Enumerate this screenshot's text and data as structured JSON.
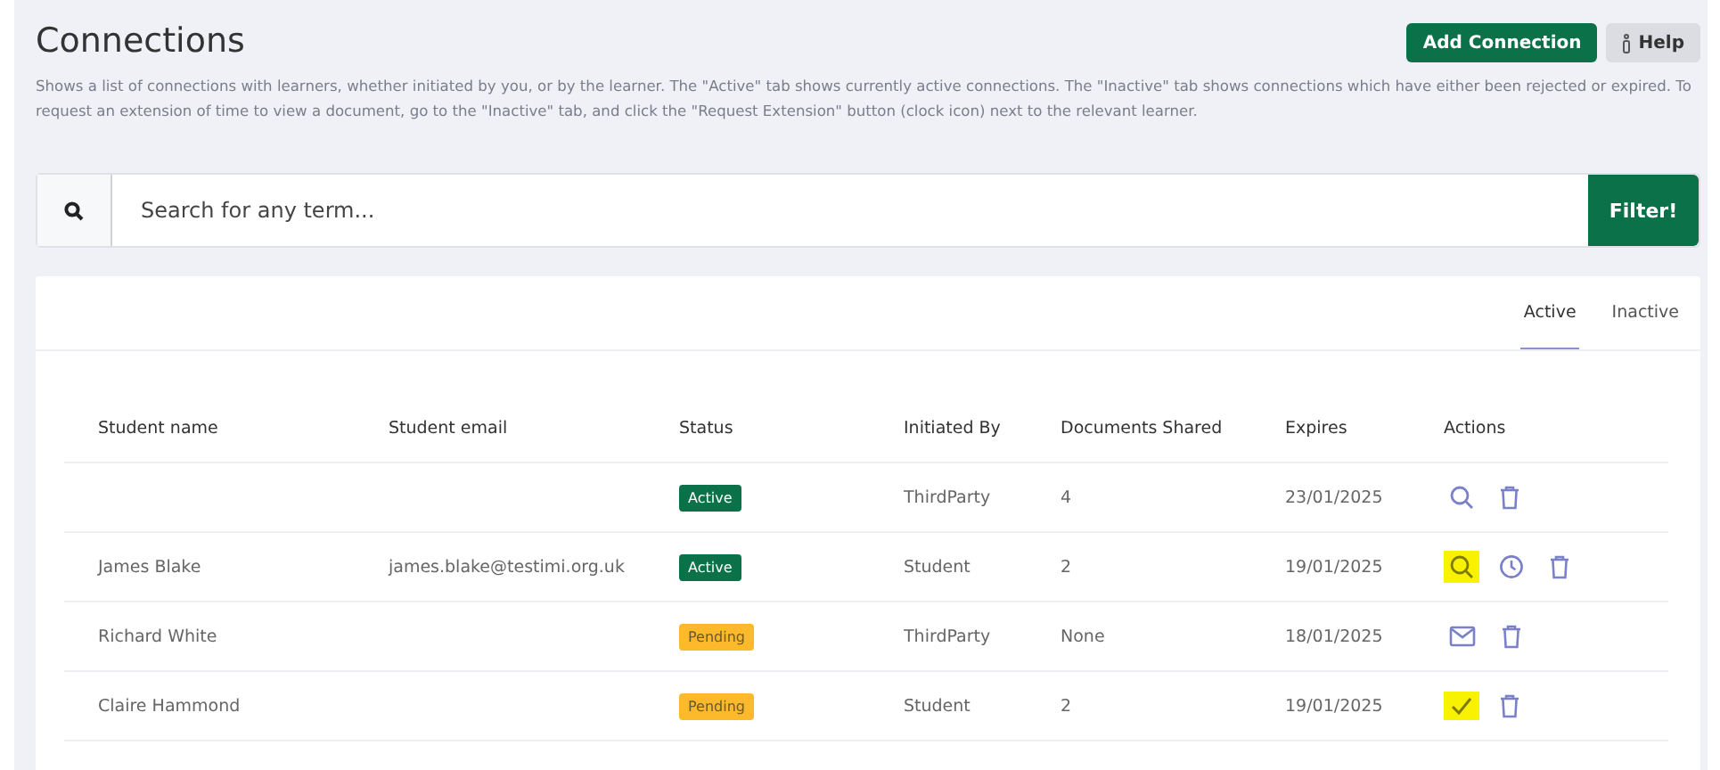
{
  "page": {
    "title": "Connections",
    "description": "Shows a list of connections with learners, whether initiated by you, or by the learner. The \"Active\" tab shows currently active connections. The \"Inactive\" tab shows connections which have either been rejected or expired. To request an extension of time to view a document, go to the \"Inactive\" tab, and click the \"Request Extension\" button (clock icon) next to the relevant learner."
  },
  "header_buttons": [
    {
      "label": "Add Connection",
      "kind": "primary"
    },
    {
      "label": "Help",
      "kind": "help"
    }
  ],
  "search": {
    "placeholder": "Search for any term...",
    "button": "Filter!"
  },
  "tabs": [
    {
      "label": "Active",
      "selected": true
    },
    {
      "label": "Inactive",
      "selected": false
    }
  ],
  "table": {
    "columns": [
      "Student name",
      "Student email",
      "Status",
      "Initiated By",
      "Documents Shared",
      "Expires",
      "Actions"
    ],
    "rows": [
      {
        "name": "",
        "email": "",
        "status": {
          "label": "Active",
          "kind": "active"
        },
        "initiated_by": "ThirdParty",
        "documents": "4",
        "expires": "23/01/2025",
        "actions": [
          {
            "kind": "view",
            "highlighted": false
          },
          {
            "kind": "delete",
            "highlighted": false
          }
        ]
      },
      {
        "name": "James Blake",
        "email": "james.blake@testimi.org.uk",
        "status": {
          "label": "Active",
          "kind": "active"
        },
        "initiated_by": "Student",
        "documents": "2",
        "expires": "19/01/2025",
        "actions": [
          {
            "kind": "view",
            "highlighted": true
          },
          {
            "kind": "extend",
            "highlighted": false
          },
          {
            "kind": "delete",
            "highlighted": false
          }
        ]
      },
      {
        "name": "Richard White",
        "email": "",
        "status": {
          "label": "Pending",
          "kind": "pending"
        },
        "initiated_by": "ThirdParty",
        "documents": "None",
        "expires": "18/01/2025",
        "actions": [
          {
            "kind": "message",
            "highlighted": false
          },
          {
            "kind": "delete",
            "highlighted": false
          }
        ]
      },
      {
        "name": "Claire Hammond",
        "email": "",
        "status": {
          "label": "Pending",
          "kind": "pending"
        },
        "initiated_by": "Student",
        "documents": "2",
        "expires": "19/01/2025",
        "actions": [
          {
            "kind": "accept",
            "highlighted": true
          },
          {
            "kind": "delete",
            "highlighted": false
          }
        ]
      }
    ]
  }
}
